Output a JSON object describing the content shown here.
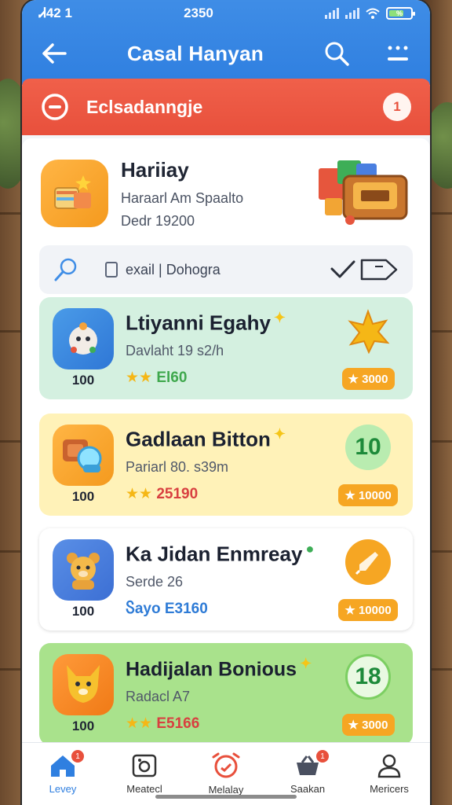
{
  "status_bar": {
    "carrier": "Ꮧ42 1",
    "time": "2350",
    "battery": "%"
  },
  "header": {
    "title": "Casal Hanyan"
  },
  "banner": {
    "label": "Eclsadanngje",
    "count": "1"
  },
  "profile": {
    "name": "Hariiay",
    "subtitle": "Haraarl Am Spaalto",
    "deal": "Dedr 19200"
  },
  "search": {
    "text": "exail | Dohogra"
  },
  "cards": [
    {
      "title": "Ltiyanni Egahy",
      "subtitle": "Davlaht 19 s2/h",
      "rating_stars": "★★",
      "rating_value": "El60",
      "level": "100",
      "reward": "3000",
      "bg": "#d4f0e0",
      "value_color": "#3fa84d"
    },
    {
      "title": "Gadlaan Bitton",
      "subtitle": "Pariarl 80. s39m",
      "rating_stars": "★★",
      "rating_value": "25190",
      "level": "100",
      "reward": "10000",
      "reward_circle": "10",
      "bg": "#fff2b8",
      "value_color": "#d84040"
    },
    {
      "title": "Ka Jidan Enmreay",
      "subtitle": "Serde 26",
      "rating_stars": "Ⴝayo",
      "rating_value": "E3160",
      "level": "100",
      "reward": "10000",
      "bg": "#ffffff",
      "value_color": "#2e7bd6"
    },
    {
      "title": "Hadijalan Bonious",
      "subtitle": "Radacl A7",
      "rating_stars": "★★",
      "rating_value": "E5166",
      "level": "100",
      "reward": "3000",
      "reward_circle": "18",
      "bg": "#a9e28c",
      "value_color": "#d84040"
    }
  ],
  "nav": {
    "tab1": "Levey",
    "tab2": "Meatecl",
    "tab3": "Melalay",
    "tab4": "Saakan",
    "tab5": "Mericers",
    "badge1": "1",
    "badge4": "1"
  },
  "colors": {
    "header": "#2f7fe0",
    "banner": "#e8503c",
    "accent_orange": "#f6a623"
  }
}
